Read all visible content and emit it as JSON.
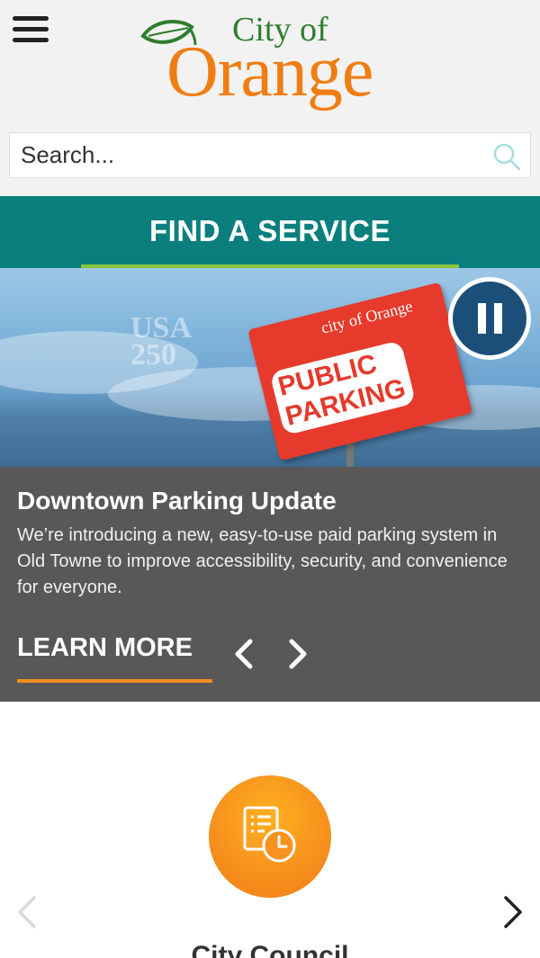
{
  "header": {
    "logo_line1": "City of",
    "logo_line2": "Orange",
    "search_placeholder": "Search..."
  },
  "find_service": {
    "label": "FIND A SERVICE"
  },
  "hero": {
    "sign_top": "city of Orange",
    "sign_line1": "PUBLIC",
    "sign_line2": "PARKING",
    "watermark_line1": "USA",
    "watermark_line2": "250"
  },
  "caption": {
    "title": "Downtown Parking Update",
    "text": "We’re introducing a new, easy-to-use paid parking system in Old Towne to improve accessibility, security, and convenience for everyone.",
    "learn_more": "LEARN MORE"
  },
  "services": {
    "current_label": "City Council"
  },
  "colors": {
    "header_bg": "#f2f2f2",
    "teal": "#0a7f7e",
    "green_accent": "#8bc53f",
    "orange": "#f07d12",
    "caption_bg": "#585858",
    "pause_bg": "#1b4f7a"
  },
  "icons": {
    "menu": "hamburger-icon",
    "search": "search-icon",
    "pause": "pause-icon",
    "prev": "chevron-left-icon",
    "next": "chevron-right-icon",
    "council": "document-clock-icon"
  }
}
